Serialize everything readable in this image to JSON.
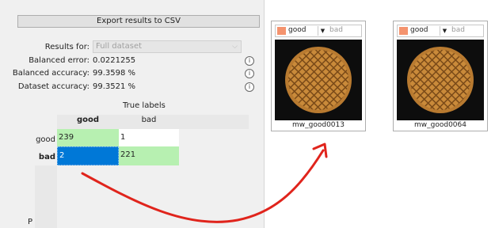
{
  "export": {
    "label": "Export results to CSV"
  },
  "results_for": {
    "label": "Results for:",
    "value": "Full dataset"
  },
  "metrics": [
    {
      "label": "Balanced error:",
      "value": "0.0221255"
    },
    {
      "label": "Balanced accuracy:",
      "value": "99.3598 %"
    },
    {
      "label": "Dataset accuracy:",
      "value": "99.3521 %"
    }
  ],
  "confusion": {
    "title": "True labels",
    "columns": [
      "good",
      "bad"
    ],
    "rows": [
      {
        "label": "good",
        "cells": [
          "239",
          "1"
        ]
      },
      {
        "label": "bad",
        "cells": [
          "2",
          "221"
        ]
      }
    ],
    "predicted_axis_letter": "P"
  },
  "thumbnails": [
    {
      "selected_class": "good",
      "other_class": "bad",
      "caption": "mw_good0013"
    },
    {
      "selected_class": "good",
      "other_class": "bad",
      "caption": "mw_good0064"
    }
  ],
  "colors": {
    "match_cell": "#b7f0b1",
    "selected_cell": "#0078d7",
    "arrow": "#e0241c",
    "class_swatch": "#f4936e"
  },
  "icons": {
    "info": "info-icon",
    "dropdown": "chevron-down-icon"
  }
}
